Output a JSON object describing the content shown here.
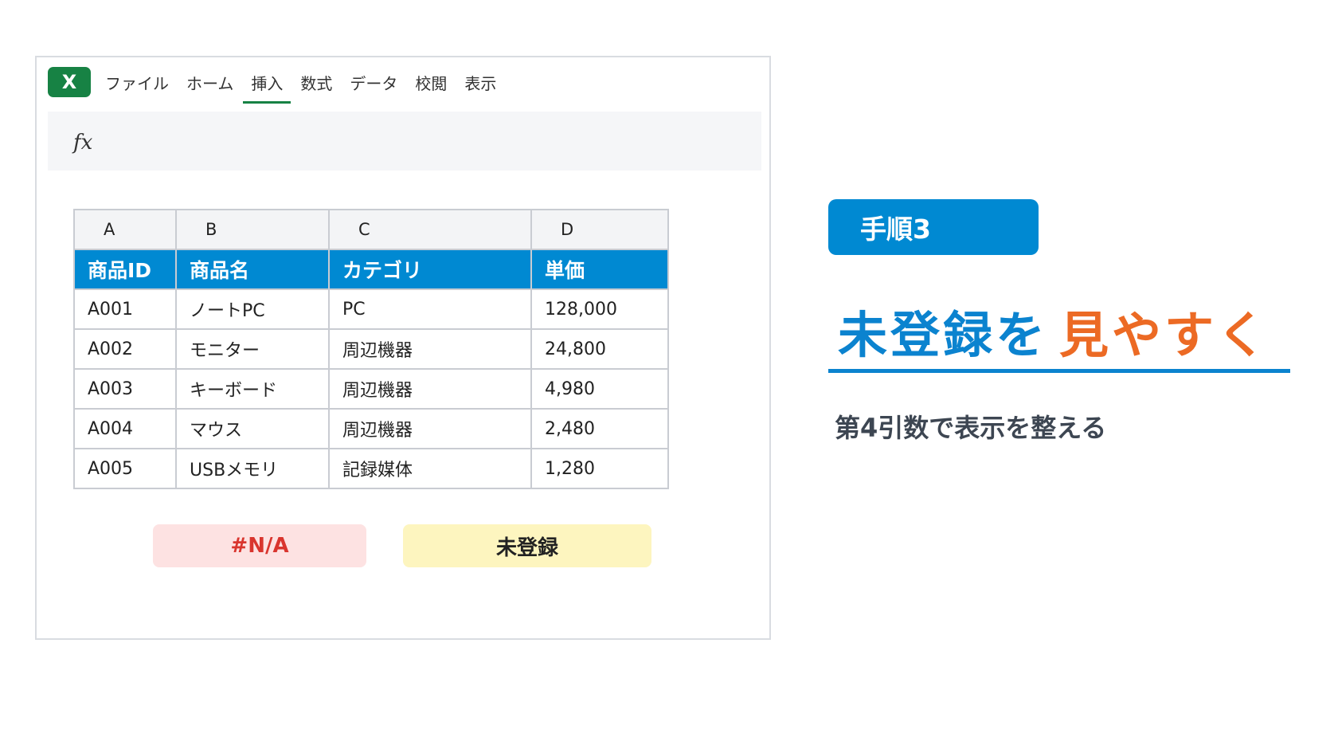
{
  "app": {
    "logo_text": "X",
    "menu": [
      "ファイル",
      "ホーム",
      "挿入",
      "数式",
      "データ",
      "校閲",
      "表示"
    ],
    "active_menu": "挿入",
    "formula_label": "fx"
  },
  "sheet": {
    "column_letters": [
      "A",
      "B",
      "C",
      "D"
    ],
    "headers": [
      "商品ID",
      "商品名",
      "カテゴリ",
      "単価"
    ],
    "rows": [
      [
        "A001",
        "ノートPC",
        "PC",
        "128,000"
      ],
      [
        "A002",
        "モニター",
        "周辺機器",
        "24,800"
      ],
      [
        "A003",
        "キーボード",
        "周辺機器",
        "4,980"
      ],
      [
        "A004",
        "マウス",
        "周辺機器",
        "2,480"
      ],
      [
        "A005",
        "USBメモリ",
        "記録媒体",
        "1,280"
      ]
    ]
  },
  "badges": {
    "na": "#N/A",
    "unregistered": "未登録"
  },
  "panel": {
    "step": "手順3",
    "title_blue": "未登録を",
    "title_orange": "見やすく",
    "subtitle": "第4引数で表示を整える"
  },
  "colors": {
    "excel_green": "#178244",
    "accent_blue": "#0089d2",
    "accent_orange": "#ec6a24",
    "na_bg": "#fde2e2",
    "na_text": "#d9352e",
    "unreg_bg": "#fdf5bf"
  }
}
